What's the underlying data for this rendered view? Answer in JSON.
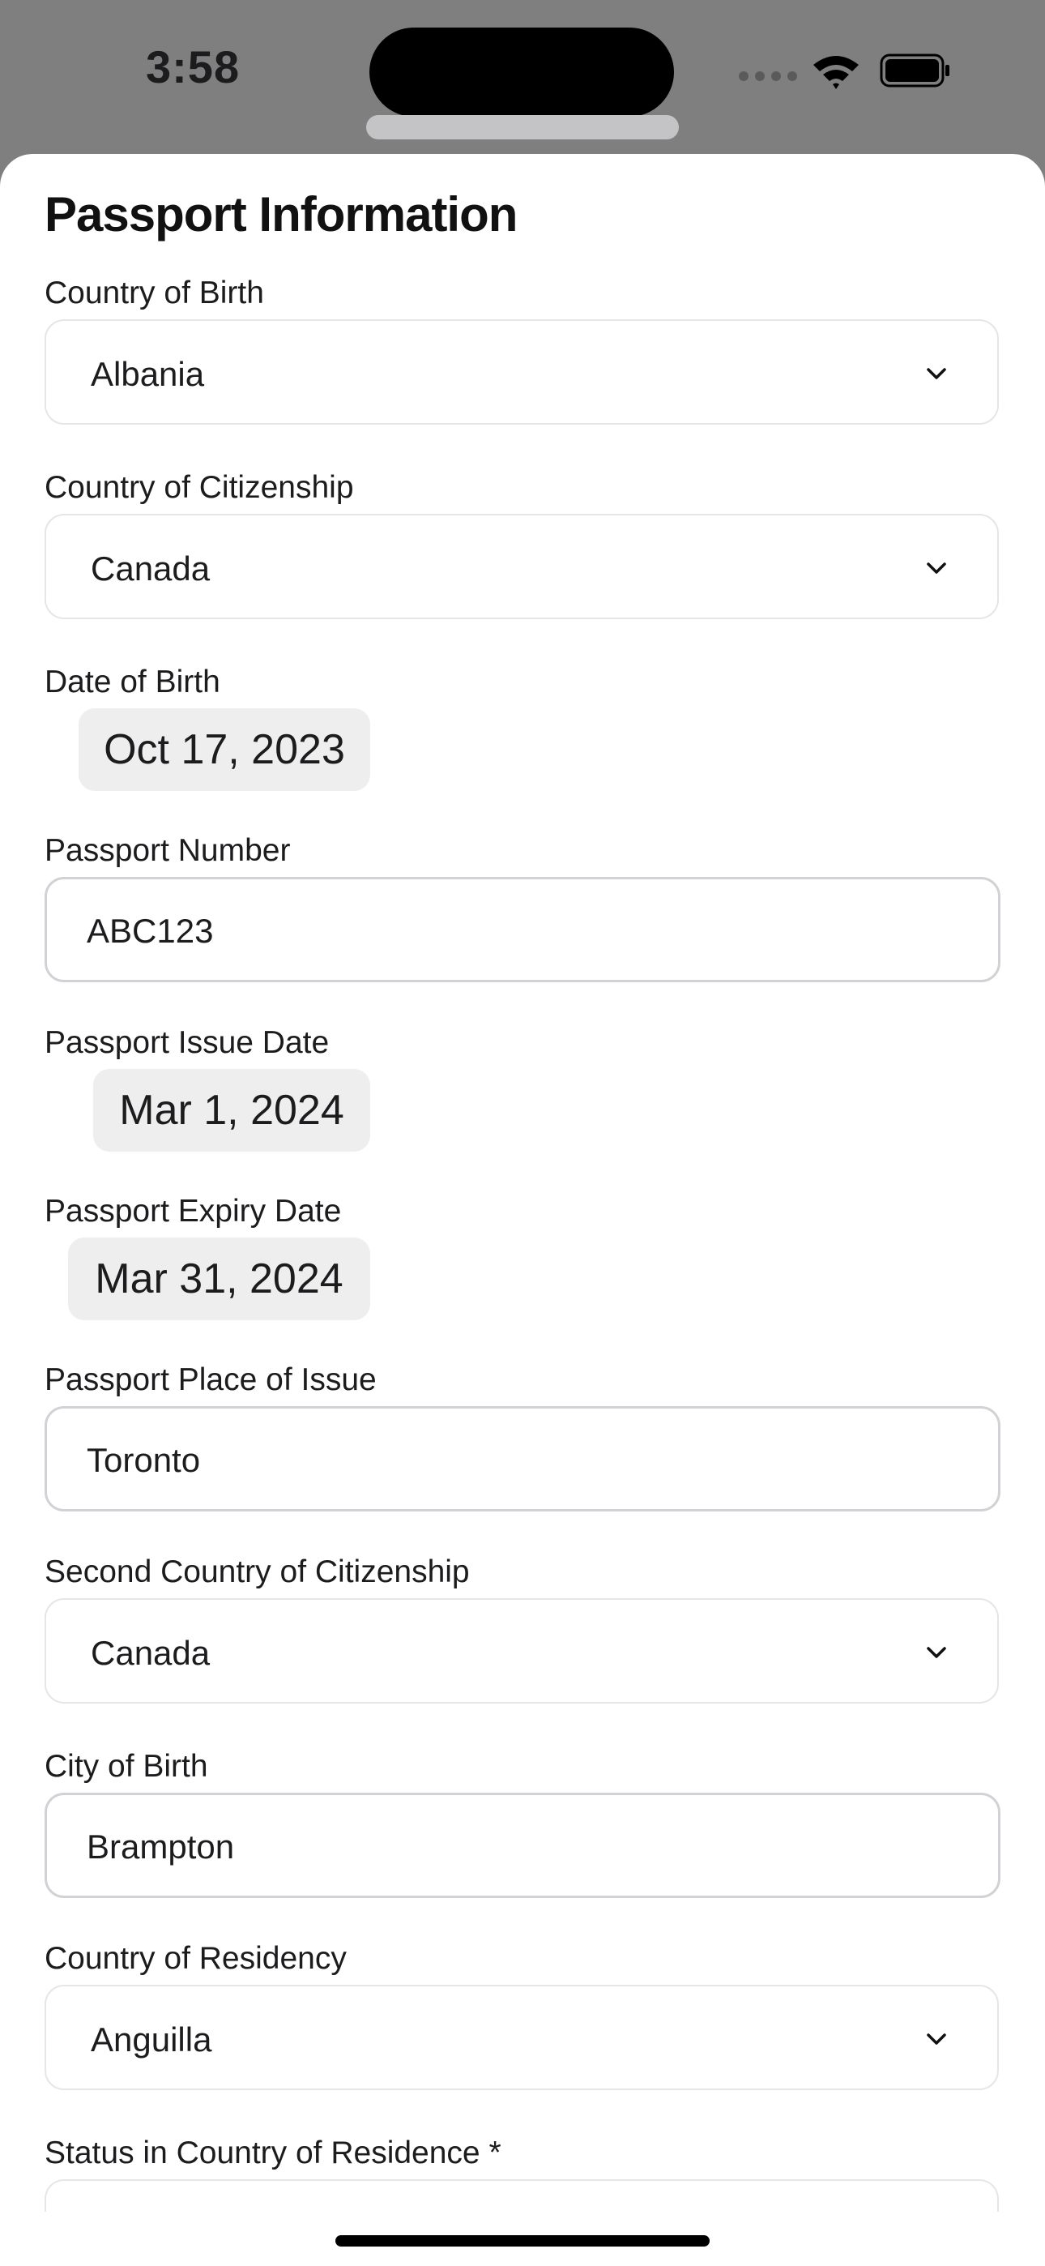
{
  "status_bar": {
    "time": "3:58",
    "icons": [
      "signal-dots-icon",
      "wifi-icon",
      "battery-icon"
    ]
  },
  "form": {
    "title": "Passport Information",
    "country_of_birth": {
      "label": "Country of Birth",
      "value": "Albania"
    },
    "country_of_citizenship": {
      "label": "Country of Citizenship",
      "value": "Canada"
    },
    "date_of_birth": {
      "label": "Date of Birth",
      "value": "Oct 17, 2023"
    },
    "passport_number": {
      "label": "Passport Number",
      "value": "ABC123"
    },
    "passport_issue_date": {
      "label": "Passport Issue Date",
      "value": "Mar 1, 2024"
    },
    "passport_expiry_date": {
      "label": "Passport Expiry Date",
      "value": "Mar 31, 2024"
    },
    "passport_place_of_issue": {
      "label": "Passport Place of Issue",
      "value": "Toronto"
    },
    "second_country_of_citizenship": {
      "label": "Second Country of Citizenship",
      "value": "Canada"
    },
    "city_of_birth": {
      "label": "City of Birth",
      "value": "Brampton"
    },
    "country_of_residency": {
      "label": "Country of Residency",
      "value": "Anguilla"
    },
    "status_in_country_of_residence": {
      "label": "Status in Country of Residence *"
    }
  }
}
